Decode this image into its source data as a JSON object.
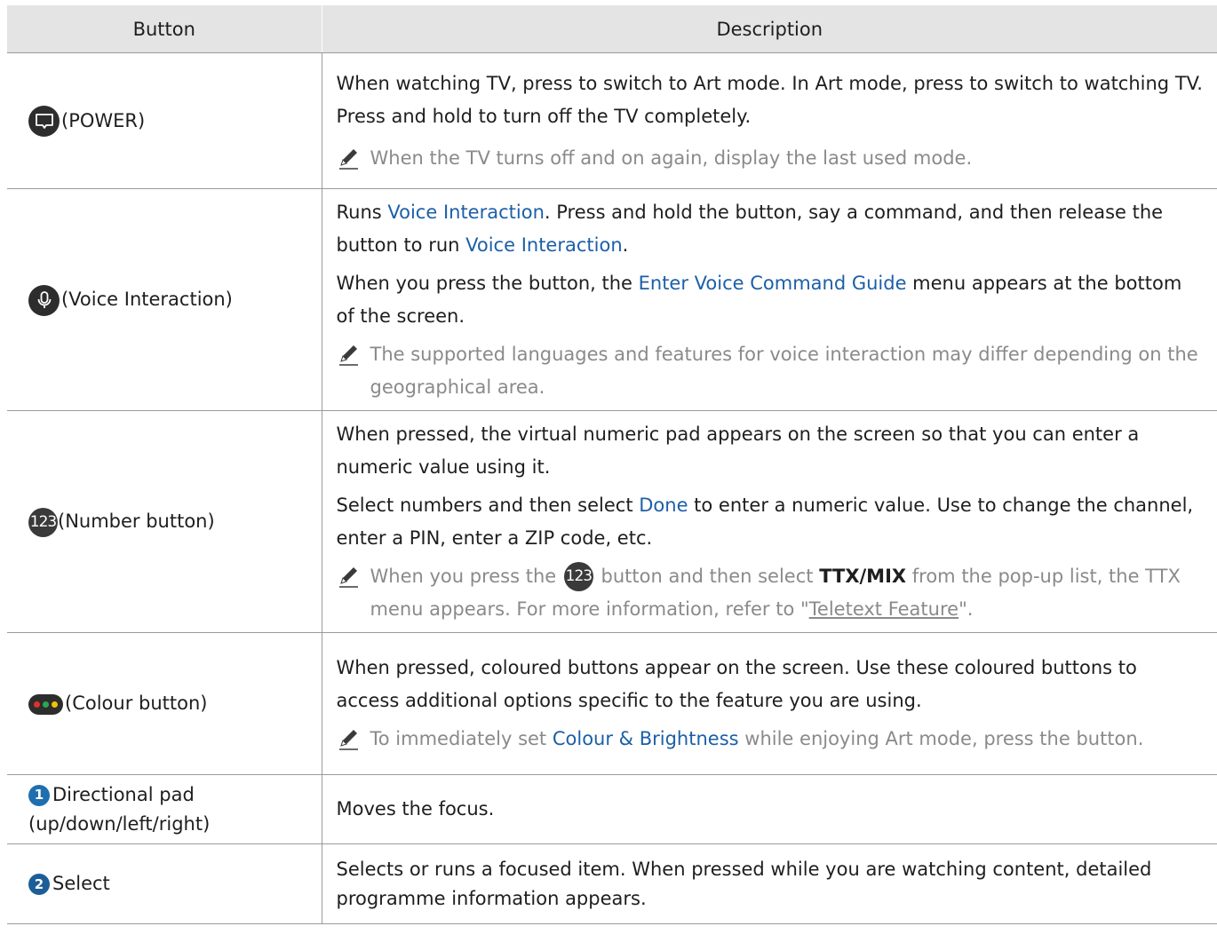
{
  "table": {
    "headers": {
      "button": "Button",
      "description": "Description"
    },
    "rows": [
      {
        "button_label": "(POWER)",
        "desc": [
          "When watching TV, press to switch to Art mode. In Art mode, press to switch to watching TV.",
          "Press and hold to turn off the TV completely."
        ],
        "note": "When the TV turns off and on again, display the last used mode."
      },
      {
        "button_label": "(Voice Interaction)",
        "desc1": {
          "a": "Runs ",
          "link1": "Voice Interaction",
          "b": ". Press and hold the button, say a command, and then release the button to run ",
          "link2": "Voice Interaction",
          "c": "."
        },
        "desc2": {
          "a": "When you press the button, the ",
          "link": "Enter Voice Command Guide",
          "b": " menu appears at the bottom of the screen."
        },
        "note": "The supported languages and features for voice interaction may differ depending on the geographical area."
      },
      {
        "button_icon_text": "123",
        "button_label": "(Number button)",
        "desc1": "When pressed, the virtual numeric pad appears on the screen so that you can enter a numeric value using it.",
        "desc2": {
          "a": "Select numbers and then select ",
          "link": "Done",
          "b": " to enter a numeric value. Use to change the channel, enter a PIN, enter a ZIP code, etc."
        },
        "note": {
          "a": "When you press the ",
          "icon_text": "123",
          "b": " button and then select ",
          "bold": "TTX/MIX",
          "c": " from the pop-up list, the TTX menu appears. For more information, refer to \"",
          "link": "Teletext Feature",
          "d": "\"."
        }
      },
      {
        "button_label": "(Colour button)",
        "dot_colors": [
          "#e03030",
          "#2aa84a",
          "#f2c200"
        ],
        "desc1": "When pressed, coloured buttons appear on the screen. Use these coloured buttons to access additional options specific to the feature you are using.",
        "note": {
          "a": "To immediately set ",
          "link": "Colour & Brightness",
          "b": " while enjoying Art mode, press the button."
        }
      },
      {
        "badge": "1",
        "button_label": "Directional pad (up/down/left/right)",
        "desc": "Moves the focus."
      },
      {
        "badge": "2",
        "button_label": "Select",
        "desc": "Selects or runs a focused item. When pressed while you are watching content, detailed programme information appears."
      }
    ]
  }
}
